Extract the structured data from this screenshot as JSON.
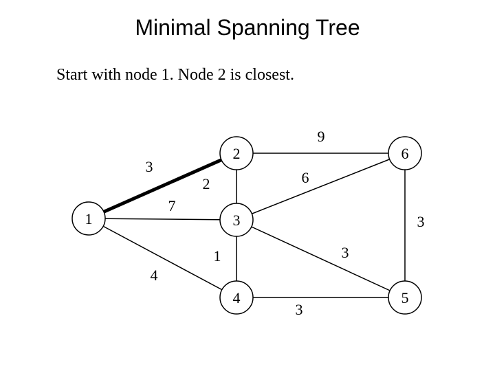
{
  "title": "Minimal Spanning Tree",
  "subtitle": "Start with node 1.  Node 2 is closest.",
  "nodes": {
    "n1": "1",
    "n2": "2",
    "n3": "3",
    "n4": "4",
    "n5": "5",
    "n6": "6"
  },
  "edges": {
    "e12": "3",
    "e13": "7",
    "e14": "4",
    "e23": "2",
    "e26": "9",
    "e34": "1",
    "e36": "6",
    "e35": "3",
    "e45": "3",
    "e56": "3"
  }
}
